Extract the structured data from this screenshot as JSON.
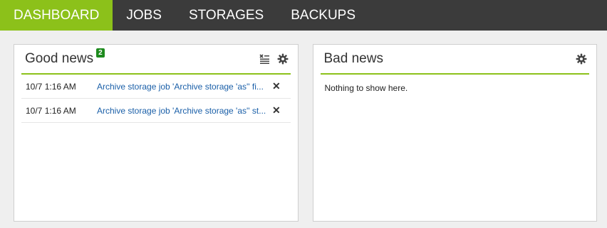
{
  "nav": {
    "items": [
      {
        "label": "DASHBOARD",
        "active": true
      },
      {
        "label": "JOBS",
        "active": false
      },
      {
        "label": "STORAGES",
        "active": false
      },
      {
        "label": "BACKUPS",
        "active": false
      }
    ]
  },
  "good_news": {
    "title": "Good news",
    "badge": "2",
    "icons": [
      "clear-all-icon",
      "gear-icon"
    ],
    "items": [
      {
        "time": "10/7 1:16 AM",
        "message": "Archive storage job 'Archive storage 'as'' fi..."
      },
      {
        "time": "10/7 1:16 AM",
        "message": "Archive storage job 'Archive storage 'as'' st..."
      }
    ]
  },
  "bad_news": {
    "title": "Bad news",
    "icons": [
      "gear-icon"
    ],
    "empty_text": "Nothing to show here."
  },
  "colors": {
    "accent": "#8cc11a",
    "nav_bg": "#3b3b3b",
    "badge": "#1d8a1d",
    "link": "#1a5fa8"
  }
}
